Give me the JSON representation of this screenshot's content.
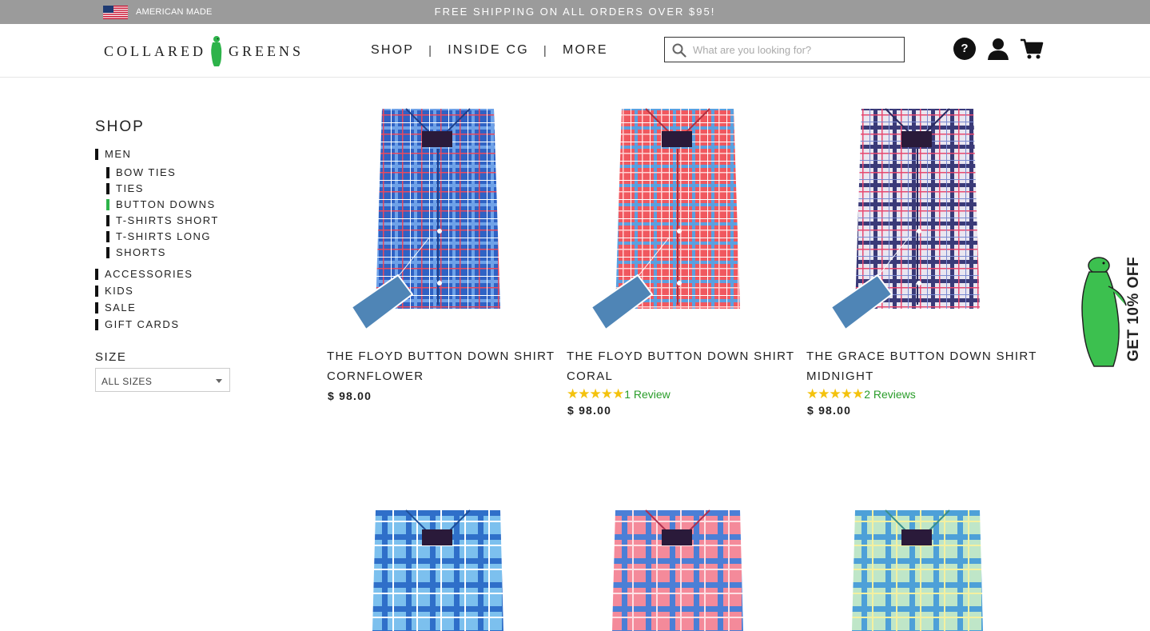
{
  "topbar": {
    "american_made": "AMERICAN MADE",
    "promo": "FREE SHIPPING ON ALL ORDERS OVER $95!"
  },
  "header": {
    "logo_left": "COLLARED",
    "logo_right": "GREENS",
    "nav": [
      "SHOP",
      "INSIDE CG",
      "MORE"
    ],
    "search_placeholder": "What are you looking for?",
    "help_icon": "?"
  },
  "sidebar": {
    "title": "SHOP",
    "men": "MEN",
    "men_sub": [
      "BOW TIES",
      "TIES",
      "BUTTON DOWNS",
      "T-SHIRTS SHORT",
      "T-SHIRTS LONG",
      "SHORTS"
    ],
    "active_sub": "BUTTON DOWNS",
    "others": [
      "ACCESSORIES",
      "KIDS",
      "SALE",
      "GIFT CARDS"
    ],
    "size_title": "SIZE",
    "size_selected": "ALL SIZES"
  },
  "products": [
    {
      "name_line1": "THE FLOYD BUTTON DOWN SHIRT",
      "name_line2": "CORNFLOWER",
      "price": "$ 98.00",
      "rating_text": "",
      "stars": ""
    },
    {
      "name_line1": "THE FLOYD BUTTON DOWN SHIRT",
      "name_line2": "CORAL",
      "price": "$ 98.00",
      "rating_text": "1 Review",
      "stars": "★★★★★"
    },
    {
      "name_line1": "THE GRACE BUTTON DOWN SHIRT",
      "name_line2": "MIDNIGHT",
      "price": "$ 98.00",
      "rating_text": "2 Reviews",
      "stars": "★★★★★"
    }
  ],
  "side_promo": "GET 10% OFF",
  "colors": {
    "accent_green": "#2db34a",
    "topbar": "#9b9b9b",
    "star": "#f4c20d",
    "review_link": "#2a9d2a"
  }
}
